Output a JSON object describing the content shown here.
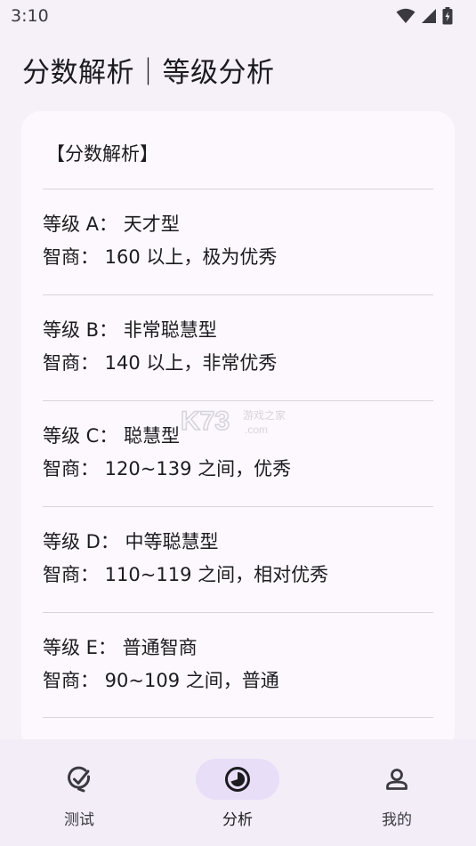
{
  "status_bar": {
    "time": "3:10"
  },
  "page": {
    "title": "分数解析｜等级分析"
  },
  "card": {
    "header": "【分数解析】",
    "grades": [
      {
        "grade": "等级 A：  天才型",
        "iq": "智商：  160 以上，极为优秀"
      },
      {
        "grade": "等级 B：  非常聪慧型",
        "iq": "智商：  140 以上，非常优秀"
      },
      {
        "grade": "等级 C：  聪慧型",
        "iq": "智商：  120~139 之间，优秀"
      },
      {
        "grade": "等级 D：  中等聪慧型",
        "iq": "智商：  110~119 之间，相对优秀"
      },
      {
        "grade": "等级 E：  普通智商",
        "iq": "智商：  90~109 之间，普通"
      }
    ],
    "watermark": {
      "main": "K73",
      "sub": "游戏之家",
      "domain": ".com"
    }
  },
  "bottom_nav": {
    "items": [
      {
        "label": "测试",
        "icon": "test-check-icon",
        "active": false
      },
      {
        "label": "分析",
        "icon": "analysis-chart-icon",
        "active": true
      },
      {
        "label": "我的",
        "icon": "profile-person-icon",
        "active": false
      }
    ],
    "active_color": "#e8def8"
  },
  "colors": {
    "background": "#f6f1f8",
    "card": "#fdf8fd",
    "text": "#1c1b1f"
  }
}
